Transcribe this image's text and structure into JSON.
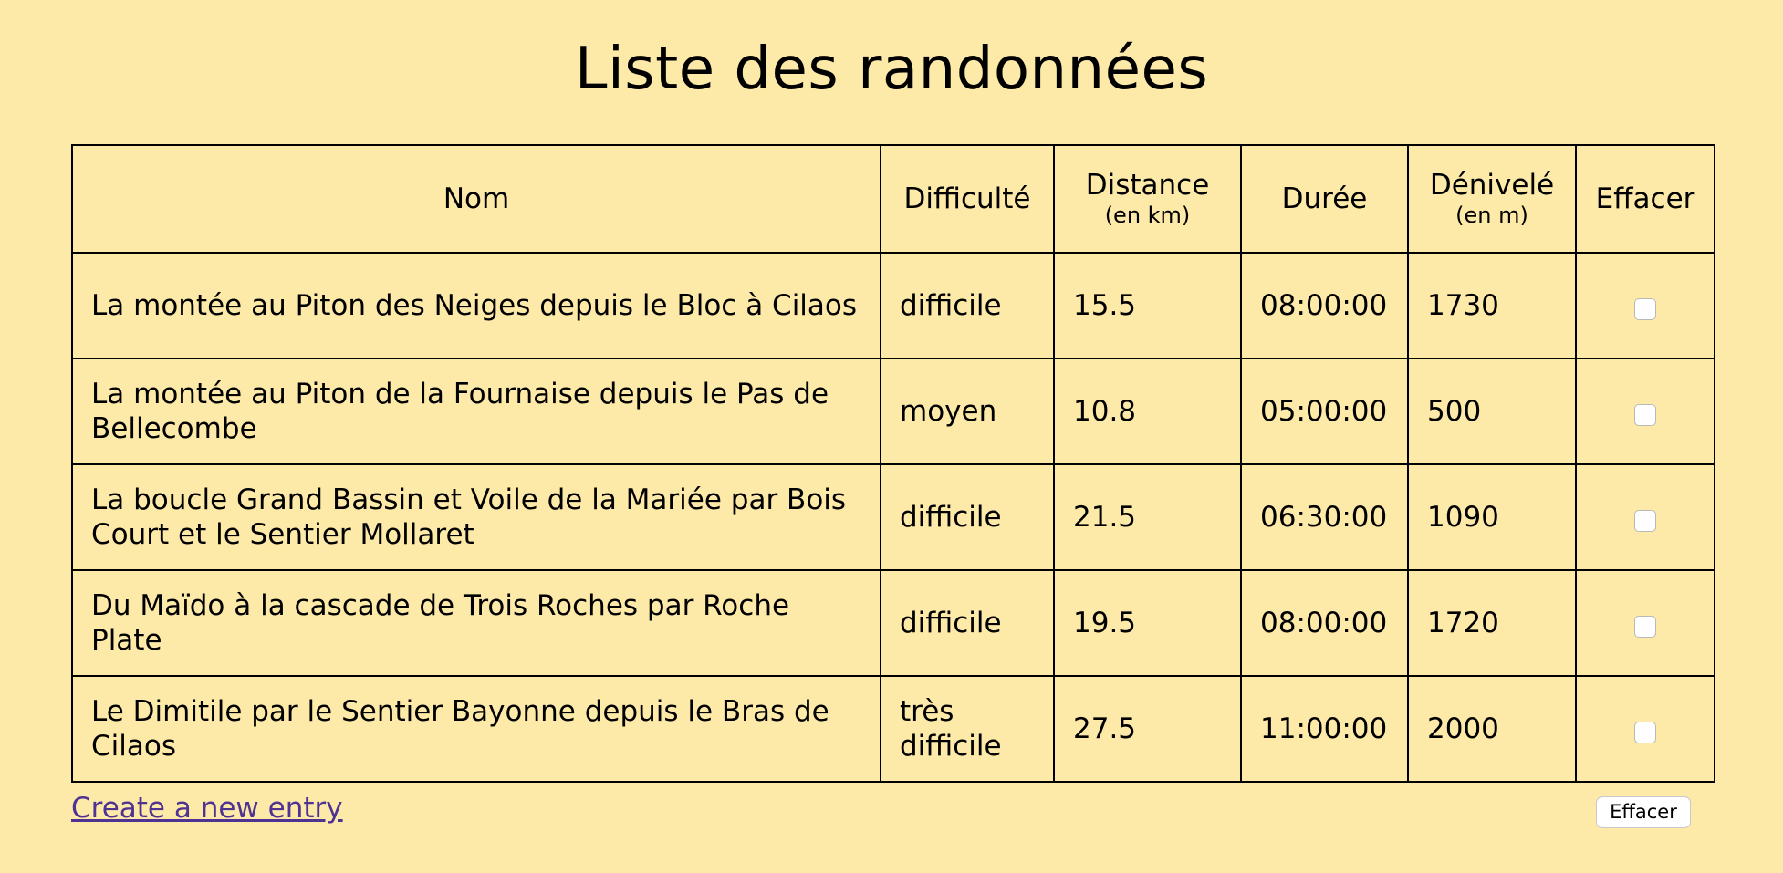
{
  "page": {
    "title": "Liste des randonnées"
  },
  "table": {
    "headers": {
      "name": "Nom",
      "difficulty": "Difficulté",
      "distance": "Distance",
      "distance_unit": "(en km)",
      "duration": "Durée",
      "elevation": "Dénivelé",
      "elevation_unit": "(en m)",
      "delete": "Effacer"
    },
    "rows": [
      {
        "name": "La montée au Piton des Neiges depuis le Bloc à Cilaos",
        "difficulty": "difficile",
        "distance": "15.5",
        "duration": "08:00:00",
        "elevation": "1730",
        "checked": false
      },
      {
        "name": "La montée au Piton de la Fournaise depuis le Pas de Bellecombe",
        "difficulty": "moyen",
        "distance": "10.8",
        "duration": "05:00:00",
        "elevation": "500",
        "checked": false
      },
      {
        "name": "La boucle Grand Bassin et Voile de la Mariée par Bois Court et le Sentier Mollaret",
        "difficulty": "difficile",
        "distance": "21.5",
        "duration": "06:30:00",
        "elevation": "1090",
        "checked": false
      },
      {
        "name": "Du Maïdo à la cascade de Trois Roches par Roche Plate",
        "difficulty": "difficile",
        "distance": "19.5",
        "duration": "08:00:00",
        "elevation": "1720",
        "checked": false
      },
      {
        "name": "Le Dimitile par le Sentier Bayonne depuis le Bras de Cilaos",
        "difficulty": "très difficile",
        "distance": "27.5",
        "duration": "11:00:00",
        "elevation": "2000",
        "checked": false
      }
    ]
  },
  "actions": {
    "create_link": "Create a new entry",
    "delete_button": "Effacer"
  },
  "colors": {
    "background": "#fde9a8",
    "link": "#4f3393",
    "border": "#000000"
  }
}
